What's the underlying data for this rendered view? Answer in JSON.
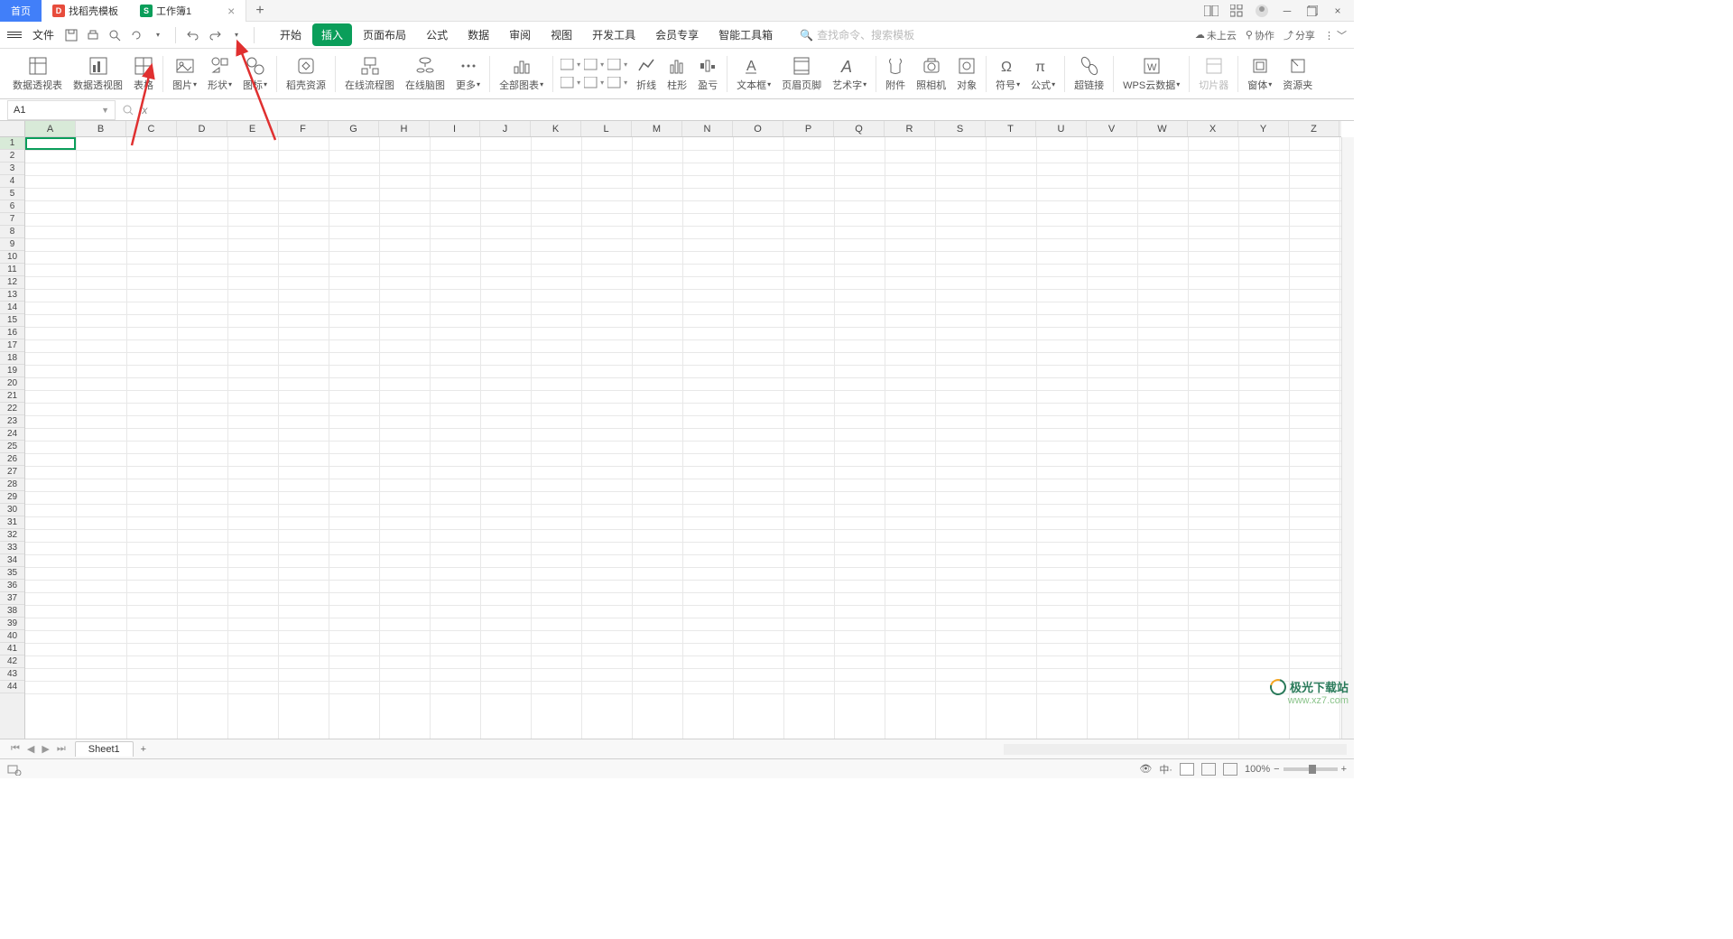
{
  "titlebar": {
    "home_tab": "首页",
    "template_tab": "找稻壳模板",
    "workbook_tab": "工作簿1",
    "template_icon": "D",
    "workbook_icon": "S"
  },
  "menubar": {
    "file": "文件",
    "tabs": [
      "开始",
      "插入",
      "页面布局",
      "公式",
      "数据",
      "审阅",
      "视图",
      "开发工具",
      "会员专享",
      "智能工具箱"
    ],
    "active_tab_index": 1,
    "search_placeholder": "查找命令、搜索模板",
    "search_prefix": "Q",
    "cloud": "未上云",
    "collab": "协作",
    "share": "分享"
  },
  "ribbon": {
    "groups": [
      {
        "label": "数据透视表",
        "dd": false
      },
      {
        "label": "数据透视图",
        "dd": false
      },
      {
        "label": "表格",
        "dd": false
      },
      {
        "label": "图片",
        "dd": true
      },
      {
        "label": "形状",
        "dd": true
      },
      {
        "label": "图标",
        "dd": true
      },
      {
        "label": "稻壳资源",
        "dd": false
      },
      {
        "label": "在线流程图",
        "dd": false
      },
      {
        "label": "在线脑图",
        "dd": false
      },
      {
        "label": "更多",
        "dd": true
      },
      {
        "label": "全部图表",
        "dd": true
      },
      {
        "label": "折线",
        "dd": false
      },
      {
        "label": "柱形",
        "dd": false
      },
      {
        "label": "盈亏",
        "dd": false
      },
      {
        "label": "文本框",
        "dd": true
      },
      {
        "label": "页眉页脚",
        "dd": false
      },
      {
        "label": "艺术字",
        "dd": true
      },
      {
        "label": "附件",
        "dd": false
      },
      {
        "label": "照相机",
        "dd": false
      },
      {
        "label": "对象",
        "dd": false
      },
      {
        "label": "符号",
        "dd": true
      },
      {
        "label": "公式",
        "dd": true
      },
      {
        "label": "超链接",
        "dd": false
      },
      {
        "label": "WPS云数据",
        "dd": true
      },
      {
        "label": "切片器",
        "dd": false,
        "disabled": true
      },
      {
        "label": "窗体",
        "dd": true
      },
      {
        "label": "资源夹",
        "dd": false
      }
    ],
    "chart_icons": [
      "bar",
      "line",
      "pie",
      "area",
      "scatter",
      "combo"
    ],
    "camera_label": "照相机"
  },
  "formula": {
    "cell_ref": "A1",
    "fx": "fx"
  },
  "grid": {
    "columns": [
      "A",
      "B",
      "C",
      "D",
      "E",
      "F",
      "G",
      "H",
      "I",
      "J",
      "K",
      "L",
      "M",
      "N",
      "O",
      "P",
      "Q",
      "R",
      "S",
      "T",
      "U",
      "V",
      "W",
      "X",
      "Y",
      "Z"
    ],
    "row_count": 44,
    "selected": {
      "row": 1,
      "col": "A"
    }
  },
  "sheets": {
    "active": "Sheet1"
  },
  "status": {
    "zoom": "100%"
  },
  "watermark": {
    "brand": "极光下载站",
    "url": "www.xz7.com"
  }
}
